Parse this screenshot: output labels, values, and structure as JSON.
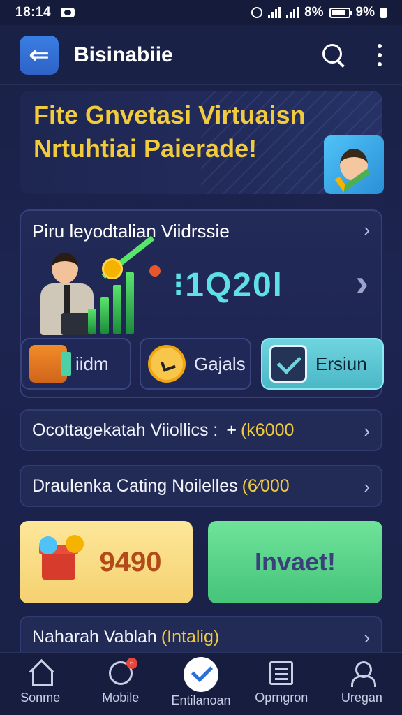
{
  "status_bar": {
    "time": "18:14",
    "battery_text": "8%",
    "battery_text_2": "9%"
  },
  "header": {
    "title": "Bisinabiie",
    "back_icon": "arrow-left-icon",
    "search_icon": "search-icon",
    "more_icon": "more-vertical-icon"
  },
  "hero": {
    "line1": "Fite Gnvetasi Virtuaisn",
    "line2": "Nrtuhtiai Paierade!"
  },
  "performance": {
    "title": "Piru leyodtalian Viidrssie",
    "value": "⁝1Q20l",
    "chips": [
      {
        "label": "iidm",
        "icon": "gift-box-icon"
      },
      {
        "label": "Gajals",
        "icon": "clock-icon"
      },
      {
        "label": "Ersiun",
        "icon": "checkmark-icon"
      }
    ]
  },
  "rows": [
    {
      "label": "Ocottagekatah Viiollics :",
      "prefix": "+",
      "highlight": "(k6000"
    },
    {
      "label": "Draulenka Cating Noilelles",
      "highlight": "(6⁄000"
    },
    {
      "label": "Naharah Vablah",
      "highlight": "(Intalig)"
    }
  ],
  "buttons": {
    "reward_value": "9490",
    "invite_label": "Invaet!"
  },
  "nav": [
    {
      "label": "Sonme",
      "icon": "home-icon"
    },
    {
      "label": "Mobile",
      "icon": "mobile-icon",
      "badge": "6"
    },
    {
      "label": "Entilanoan",
      "icon": "check-circle-icon"
    },
    {
      "label": "Oprngron",
      "icon": "list-icon"
    },
    {
      "label": "Uregan",
      "icon": "user-icon"
    }
  ],
  "colors": {
    "background": "#1c2450",
    "accent_yellow": "#f2cb3c",
    "accent_cyan": "#5fe0e6",
    "accent_blue": "#2f62c6",
    "accent_green": "#45c47a"
  }
}
